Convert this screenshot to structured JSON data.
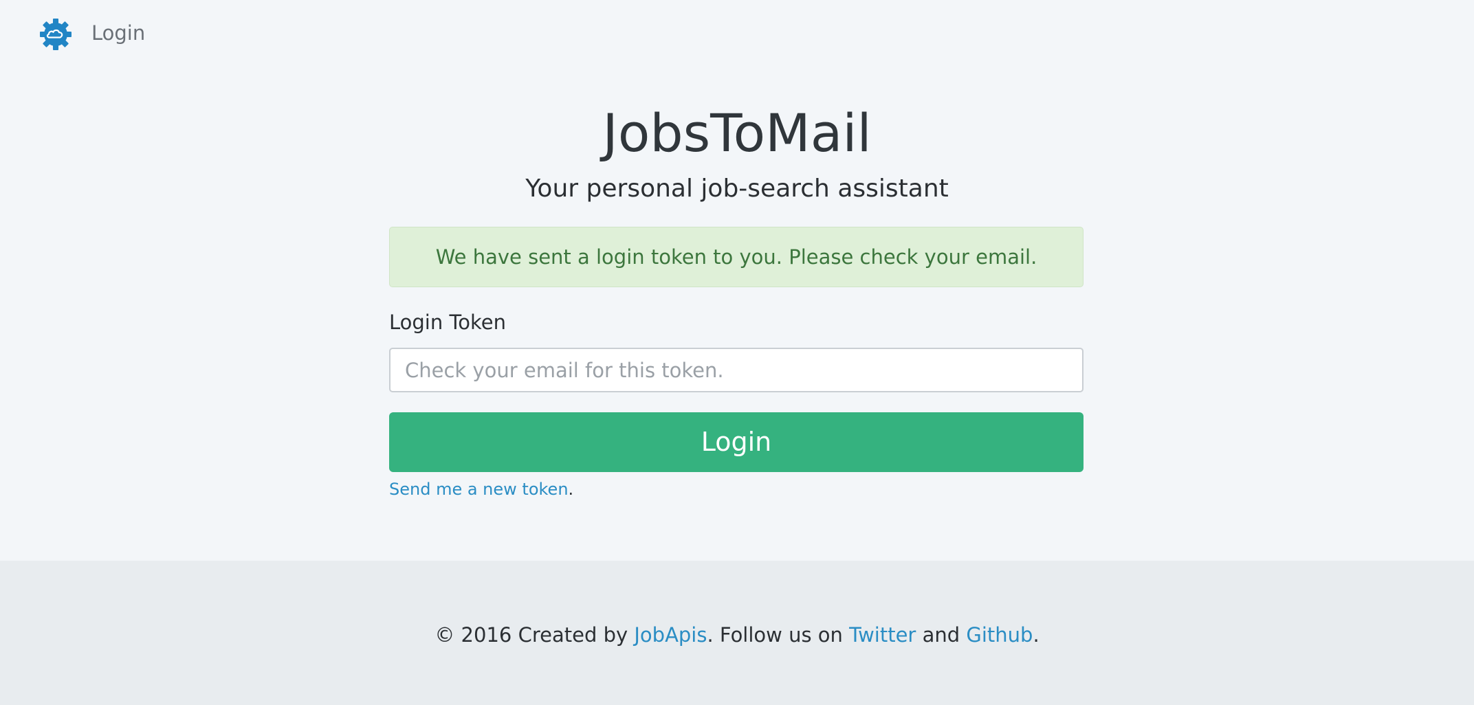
{
  "navbar": {
    "logo_icon": "gear-cloud-icon",
    "login_link": "Login"
  },
  "main": {
    "title": "JobsToMail",
    "subtitle": "Your personal job-search assistant",
    "alert": "We have sent a login token to you. Please check your email.",
    "form": {
      "token_label": "Login Token",
      "token_value": "",
      "token_placeholder": "Check your email for this token.",
      "submit_label": "Login",
      "resend_link": "Send me a new token",
      "resend_suffix": "."
    }
  },
  "footer": {
    "copyright_prefix": "© 2016 Created by ",
    "jobapis_link": "JobApis",
    "follow_text": ". Follow us on ",
    "twitter_link": "Twitter",
    "and_text": " and ",
    "github_link": "Github",
    "end_text": "."
  },
  "colors": {
    "accent": "#35b27f",
    "link": "#2a8dc4",
    "alert_bg": "#dff0d8",
    "alert_text": "#3c763d",
    "icon": "#2185c5"
  }
}
